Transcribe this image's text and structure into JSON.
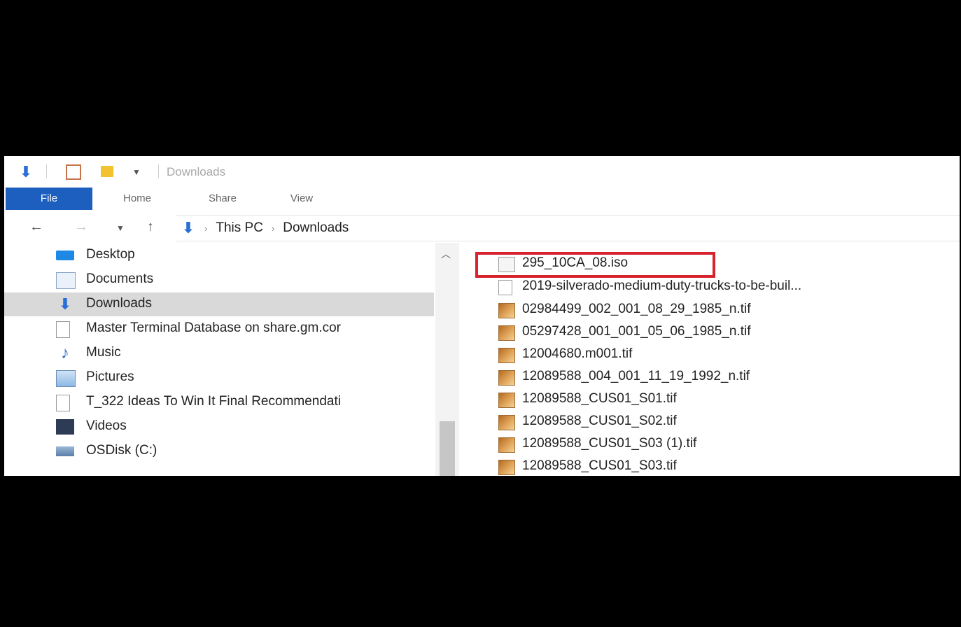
{
  "window": {
    "title": "Downloads"
  },
  "ribbon": {
    "tabs": [
      {
        "label": "File"
      },
      {
        "label": "Home"
      },
      {
        "label": "Share"
      },
      {
        "label": "View"
      }
    ]
  },
  "address": {
    "crumbs": [
      "This PC",
      "Downloads"
    ]
  },
  "navpane": {
    "items": [
      {
        "label": "Desktop",
        "icon": "desktop-icon"
      },
      {
        "label": "Documents",
        "icon": "documents-icon"
      },
      {
        "label": "Downloads",
        "icon": "downloads-icon",
        "selected": true
      },
      {
        "label": "Master Terminal Database on share.gm.cor",
        "icon": "file-icon"
      },
      {
        "label": "Music",
        "icon": "music-icon"
      },
      {
        "label": "Pictures",
        "icon": "pictures-icon"
      },
      {
        "label": "T_322 Ideas To Win It Final Recommendati",
        "icon": "file-icon"
      },
      {
        "label": "Videos",
        "icon": "videos-icon"
      },
      {
        "label": "OSDisk (C:)",
        "icon": "drive-icon"
      }
    ]
  },
  "files": [
    {
      "name": "295_10CA_08.iso",
      "icon": "iso-file-icon",
      "highlighted": true
    },
    {
      "name": "2019-silverado-medium-duty-trucks-to-be-buil...",
      "icon": "file-icon"
    },
    {
      "name": "02984499_002_001_08_29_1985_n.tif",
      "icon": "image-file-icon"
    },
    {
      "name": "05297428_001_001_05_06_1985_n.tif",
      "icon": "image-file-icon"
    },
    {
      "name": "12004680.m001.tif",
      "icon": "image-file-icon"
    },
    {
      "name": "12089588_004_001_11_19_1992_n.tif",
      "icon": "image-file-icon"
    },
    {
      "name": "12089588_CUS01_S01.tif",
      "icon": "image-file-icon"
    },
    {
      "name": "12089588_CUS01_S02.tif",
      "icon": "image-file-icon"
    },
    {
      "name": "12089588_CUS01_S03 (1).tif",
      "icon": "image-file-icon"
    },
    {
      "name": "12089588_CUS01_S03.tif",
      "icon": "image-file-icon"
    }
  ],
  "colors": {
    "accent": "#1c5fbf",
    "highlight_box": "#d6232e",
    "selected_row": "#d9d9d9"
  }
}
